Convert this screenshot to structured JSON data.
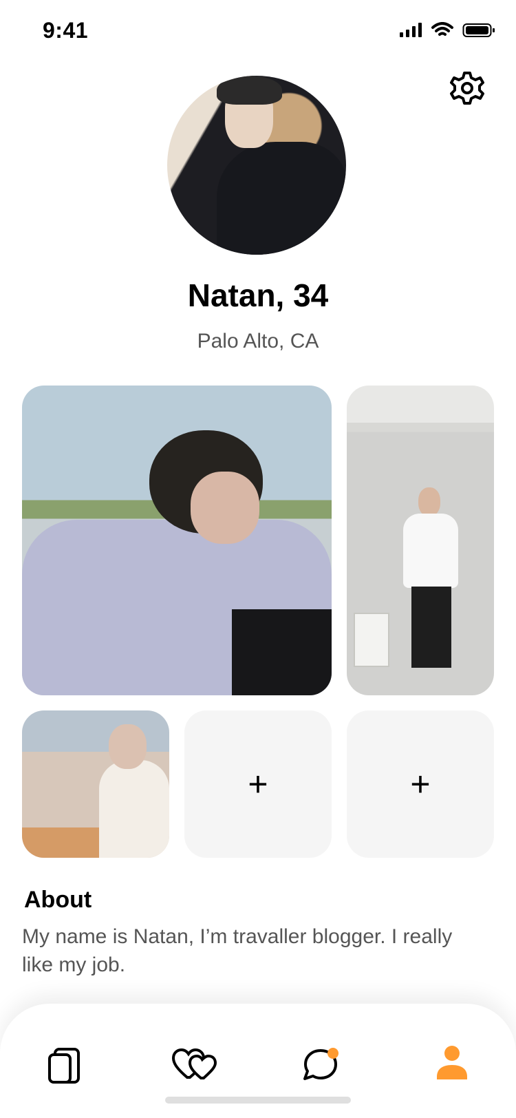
{
  "status_bar": {
    "time": "9:41"
  },
  "profile": {
    "name_age": "Natan, 34",
    "location": "Palo Alto, CA"
  },
  "photos": {
    "add_labels": [
      "+",
      "+"
    ]
  },
  "about": {
    "title": "About",
    "text": "My name is Natan, I’m travaller blogger. I really like my job."
  },
  "colors": {
    "accent": "#ff9a2f",
    "tile_bg": "#f5f5f5",
    "text_muted": "#555555"
  },
  "icons": {
    "settings": "gear-icon",
    "cards": "cards-icon",
    "likes": "hearts-icon",
    "messages": "chat-icon",
    "profile": "person-icon"
  }
}
